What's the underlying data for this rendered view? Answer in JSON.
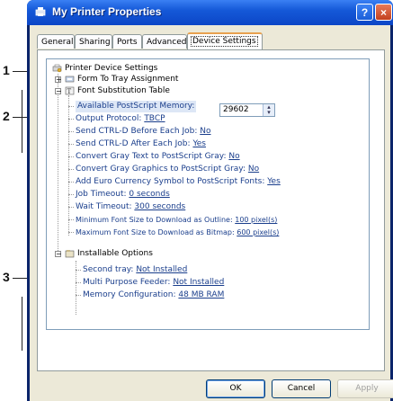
{
  "window": {
    "title": "My Printer Properties",
    "help_label": "?",
    "close_label": "×"
  },
  "callouts": [
    "1",
    "2",
    "3"
  ],
  "tabs": [
    {
      "label": "General"
    },
    {
      "label": "Sharing"
    },
    {
      "label": "Ports"
    },
    {
      "label": "Advanced"
    },
    {
      "label": "Device Settings"
    }
  ],
  "tree": {
    "root": "Printer Device Settings",
    "form_tray": "Form To Tray Assignment",
    "font_sub": "Font Substitution Table",
    "avail_mem_label": "Available PostScript Memory:",
    "avail_mem_value": "29602",
    "output_protocol_key": "Output Protocol:",
    "output_protocol_val": "TBCP",
    "send_ctrl_before_key": "Send CTRL-D Before Each Job:",
    "send_ctrl_before_val": "No",
    "send_ctrl_after_key": "Send CTRL-D After Each Job:",
    "send_ctrl_after_val": "Yes",
    "convert_gray_text_key": "Convert Gray Text to PostScript Gray:",
    "convert_gray_text_val": "No",
    "convert_gray_graphics_key": "Convert Gray Graphics to PostScript Gray:",
    "convert_gray_graphics_val": "No",
    "euro_key": "Add Euro Currency Symbol to PostScript Fonts:",
    "euro_val": "Yes",
    "job_timeout_key": "Job Timeout:",
    "job_timeout_val": "0 seconds",
    "wait_timeout_key": "Wait Timeout:",
    "wait_timeout_val": "300 seconds",
    "min_font_key": "Minimum Font Size to Download as Outline:",
    "min_font_val": "100 pixel(s)",
    "max_font_key": "Maximum Font Size to Download as Bitmap:",
    "max_font_val": "600 pixel(s)",
    "installable": "Installable Options",
    "second_tray_key": "Second tray:",
    "second_tray_val": "Not Installed",
    "multi_feeder_key": "Multi Purpose Feeder:",
    "multi_feeder_val": "Not Installed",
    "memory_key": "Memory Configuration:",
    "memory_val": "48 MB RAM"
  },
  "buttons": {
    "ok": "OK",
    "cancel": "Cancel",
    "apply": "Apply"
  },
  "colors": {
    "title_bar": "#0c46c7",
    "link_value": "#1a3e8c",
    "tab_highlight": "#e8a14f"
  }
}
